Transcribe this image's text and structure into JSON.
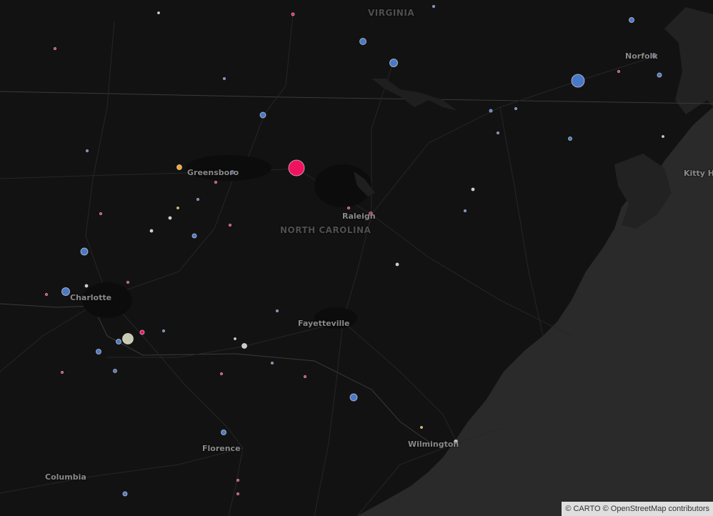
{
  "map": {
    "state_labels": {
      "virginia": "VIRGINIA",
      "north_carolina": "NORTH CAROLINA"
    },
    "city_labels": {
      "norfolk": "Norfolk",
      "greensboro": "Greensboro",
      "raleigh": "Raleigh",
      "charlotte": "Charlotte",
      "fayetteville": "Fayetteville",
      "florence": "Florence",
      "wilmington": "Wilmington",
      "columbia": "Columbia",
      "kitty_hawk": "Kitty Ha"
    },
    "attribution": "© CARTO © OpenStreetMap contributors",
    "colors": {
      "background": "#121212",
      "ocean": "#2a2a2a",
      "blue": "#4a78c8",
      "pink": "#f01160",
      "orange": "#f5a623",
      "gray": "#c8c8c8",
      "pale_yellow": "#c8cbb0"
    }
  }
}
